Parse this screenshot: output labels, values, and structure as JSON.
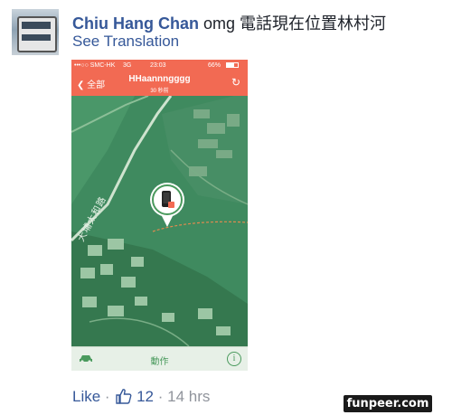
{
  "post": {
    "author": "Chiu Hang Chan",
    "message": "omg 電話現在位置林村河",
    "see_translation": "See Translation"
  },
  "phone": {
    "status": {
      "carrier": "•••○○ SMC-HK",
      "network": "3G",
      "time": "23:03",
      "battery": "66%"
    },
    "nav": {
      "back": "全部",
      "title": "HHaannngggg",
      "subtitle": "30 秒前"
    },
    "map_label": "大埔太和路",
    "toolbar": {
      "action": "動作"
    }
  },
  "footer": {
    "like": "Like",
    "separator": "·",
    "like_count": "12",
    "time": "14 hrs"
  },
  "watermark": "funpeer.com",
  "colors": {
    "fb_blue": "#365899",
    "ios_red": "#f26a53",
    "map_green": "#3f8a5f"
  }
}
